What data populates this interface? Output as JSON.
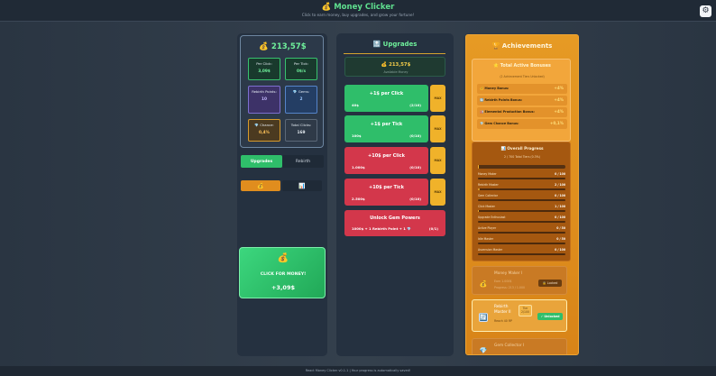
{
  "header": {
    "title": "💰 Money Clicker",
    "subtitle": "Click to earn money, buy upgrades, and grow your fortune!",
    "settings_icon": "⚙"
  },
  "stats": {
    "money": "💰 213,57$",
    "per_click_label": "Per Click:",
    "per_click_value": "3,09$",
    "per_tick_label": "Per Tick:",
    "per_tick_value": "0$/s",
    "rebirth_label": "Rebirth Points:",
    "rebirth_value": "10",
    "gems_label": "💎 Gems:",
    "gems_value": "2",
    "chance_label": "💎 Chance:",
    "chance_value": "0,4%",
    "total_clicks_label": "Total Clicks:",
    "total_clicks_value": "169"
  },
  "tabs": {
    "upgrades": "Upgrades",
    "rebirth": "Rebirth"
  },
  "subtabs": {
    "money_icon": "💰",
    "chart_icon": "📊"
  },
  "faint_icon": "💎",
  "click_card": {
    "icon": "💰",
    "label": "CLICK FOR MONEY!",
    "value": "+3,09$"
  },
  "upgrades": {
    "title": "🔝 Upgrades",
    "available_amount": "💰 213,57$",
    "available_label": "Available Money",
    "max_label": "MAX",
    "items": [
      {
        "name": "+1$ per Click",
        "cost": "40$",
        "level": "(2/10)"
      },
      {
        "name": "+1$ per Tick",
        "cost": "100$",
        "level": "(0/10)"
      },
      {
        "name": "+10$ per Click",
        "cost": "1.000$",
        "level": "(0/10)"
      },
      {
        "name": "+10$ per Tick",
        "cost": "2.500$",
        "level": "(0/10)"
      }
    ],
    "gem": {
      "name": "Unlock Gem Powers",
      "cost": "1000$ + 1 Rebirth Point + 1 💎",
      "level": "(0/1)"
    }
  },
  "achievements": {
    "title": "🏆 Achievements",
    "bonus_title": "⭐ Total Active Bonuses",
    "bonus_subtitle": "(2 Achievement Tiers Unlocked)",
    "bonuses": [
      {
        "icon": "💰",
        "label": "Money Bonus:",
        "value": "+4%"
      },
      {
        "icon": "🔄",
        "label": "Rebirth Points Bonus:",
        "value": "+4%"
      },
      {
        "icon": "🏭",
        "label": "Elemental Production Bonus:",
        "value": "+4%"
      },
      {
        "icon": "💎",
        "label": "Gem Chance Bonus:",
        "value": "+0,1%"
      }
    ],
    "overall_title": "📊 Overall Progress",
    "overall_subtitle": "2 / 700 Total Tiers (0.3%)",
    "overall_fraction": 0.003,
    "progress": [
      {
        "name": "Money Maker",
        "count": "0 / 100",
        "fraction": 0
      },
      {
        "name": "Rebirth Master",
        "count": "2 / 100",
        "fraction": 0.02
      },
      {
        "name": "Gem Collector",
        "count": "0 / 100",
        "fraction": 0
      },
      {
        "name": "Click Master",
        "count": "1 / 100",
        "fraction": 0.01
      },
      {
        "name": "Upgrade Enthusiast",
        "count": "0 / 100",
        "fraction": 0
      },
      {
        "name": "Active Player",
        "count": "0 / 50",
        "fraction": 0
      },
      {
        "name": "Idle Master",
        "count": "0 / 50",
        "fraction": 0
      },
      {
        "name": "Ascension Master",
        "count": "0 / 100",
        "fraction": 0
      }
    ],
    "cards": [
      {
        "icon": "💰",
        "name": "Money Maker I",
        "desc": "Earn 1.000$",
        "desc2": "Progress: 213 / 1.000",
        "badge": "🔒 Locked"
      },
      {
        "icon": "🔄",
        "name": "Rebirth Master II",
        "desc": "Reach 40 RP",
        "desc2": "",
        "new_tag": "Tier 2/100",
        "badge": "✓ Unlocked"
      },
      {
        "icon": "💎",
        "name": "Gem Collector I",
        "desc": "",
        "desc2": "",
        "badge": ""
      }
    ]
  },
  "footer": "React Money Clicker v0.1.1 | Your progress is automatically saved!"
}
